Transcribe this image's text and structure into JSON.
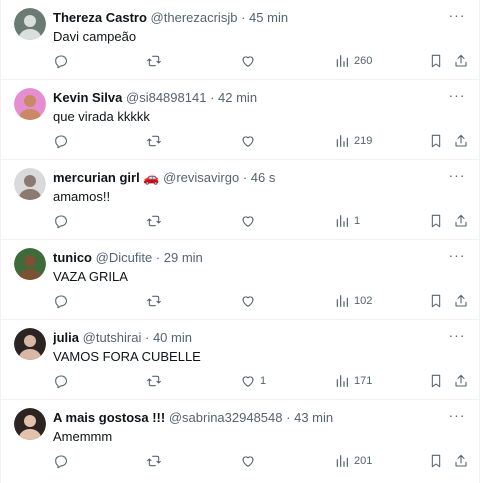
{
  "tweets": [
    {
      "name": "Thereza Castro",
      "name_suffix": "",
      "handle": "@therezacrisjb",
      "time": "45 min",
      "text": "Davi campeão",
      "likes": "",
      "views": "260",
      "avatar_bg": "#6b7b74",
      "avatar_fg": "#d9dfdc"
    },
    {
      "name": "Kevin Silva",
      "name_suffix": "",
      "handle": "@si84898141",
      "time": "42 min",
      "text": "que virada kkkkk",
      "likes": "",
      "views": "219",
      "avatar_bg": "#e58fd0",
      "avatar_fg": "#c98866"
    },
    {
      "name": "mercurian girl",
      "name_suffix": "🚗",
      "handle": "@revisavirgo",
      "time": "46 s",
      "text": "amamos!!",
      "likes": "",
      "views": "1",
      "avatar_bg": "#d9dadb",
      "avatar_fg": "#8c7a70"
    },
    {
      "name": "tunico",
      "name_suffix": "",
      "handle": "@Dicufite",
      "time": "29 min",
      "text": "VAZA GRILA",
      "likes": "",
      "views": "102",
      "avatar_bg": "#3f6b3a",
      "avatar_fg": "#7b5236"
    },
    {
      "name": "julia",
      "name_suffix": "",
      "handle": "@tutshirai",
      "time": "40 min",
      "text": "VAMOS FORA CUBELLE",
      "likes": "1",
      "views": "171",
      "avatar_bg": "#2a2522",
      "avatar_fg": "#d7b8a4"
    },
    {
      "name": "A mais gostosa !!!",
      "name_suffix": "",
      "handle": "@sabrina32948548",
      "time": "43 min",
      "text": "Amemmm",
      "likes": "",
      "views": "201",
      "avatar_bg": "#2c2421",
      "avatar_fg": "#e2c2ad"
    }
  ],
  "separator": "·",
  "more_glyph": "···",
  "colors": {
    "text": "#0f1419",
    "muted": "#536471",
    "border": "#eff3f4",
    "background": "#ffffff"
  },
  "icons": {
    "reply": "reply-icon",
    "retweet": "retweet-icon",
    "like": "heart-icon",
    "views": "views-icon",
    "bookmark": "bookmark-icon",
    "share": "share-icon",
    "more": "more-icon"
  }
}
